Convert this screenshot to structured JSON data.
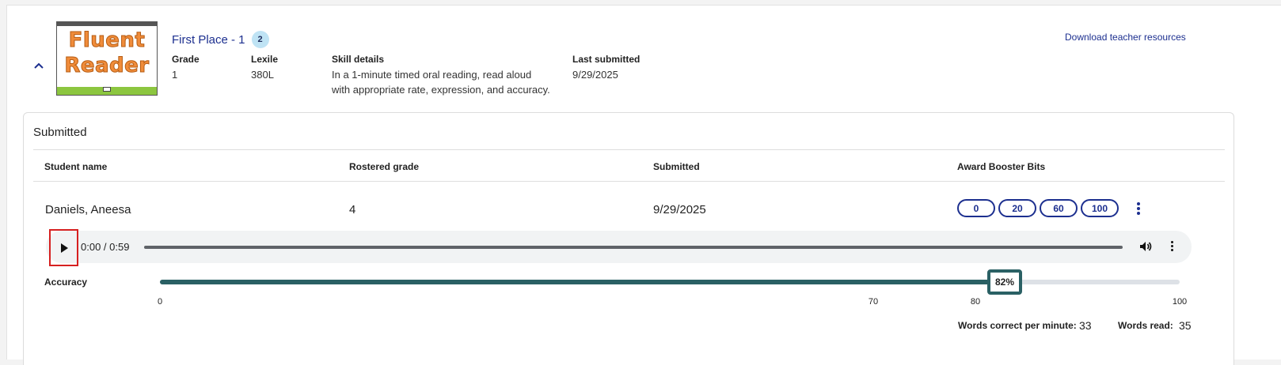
{
  "assignment": {
    "title": "First Place - 1",
    "badge_count": "2",
    "thumbnail_text": [
      "Fluent",
      "Reader"
    ],
    "grade_label": "Grade",
    "grade_value": "1",
    "lexile_label": "Lexile",
    "lexile_value": "380L",
    "skill_label": "Skill details",
    "skill_line1": "In a 1-minute timed oral reading, read aloud",
    "skill_line2": "with appropriate rate, expression, and accuracy.",
    "last_submitted_label": "Last submitted",
    "last_submitted_value": "9/29/2025",
    "download_link": "Download teacher resources"
  },
  "submitted_section": {
    "title": "Submitted",
    "columns": [
      "Student name",
      "Rostered grade",
      "Submitted",
      "Award Booster Bits"
    ],
    "row": {
      "student_name": "Daniels, Aneesa",
      "rostered_grade": "4",
      "submitted": "9/29/2025",
      "booster_options": [
        "0",
        "20",
        "60",
        "100"
      ]
    },
    "audio": {
      "time": "0:00 / 0:59"
    },
    "accuracy": {
      "label": "Accuracy",
      "value_percent": 82,
      "value_label": "82%",
      "ticks": [
        "0",
        "70",
        "80",
        "100"
      ]
    },
    "stats": {
      "wcpm_label": "Words correct per minute:",
      "wcpm_value": "33",
      "words_read_label": "Words read:",
      "words_read_value": "35"
    }
  },
  "colors": {
    "link": "#1c2f8f",
    "accuracy": "#2a6064",
    "highlight_box": "#d62020"
  }
}
